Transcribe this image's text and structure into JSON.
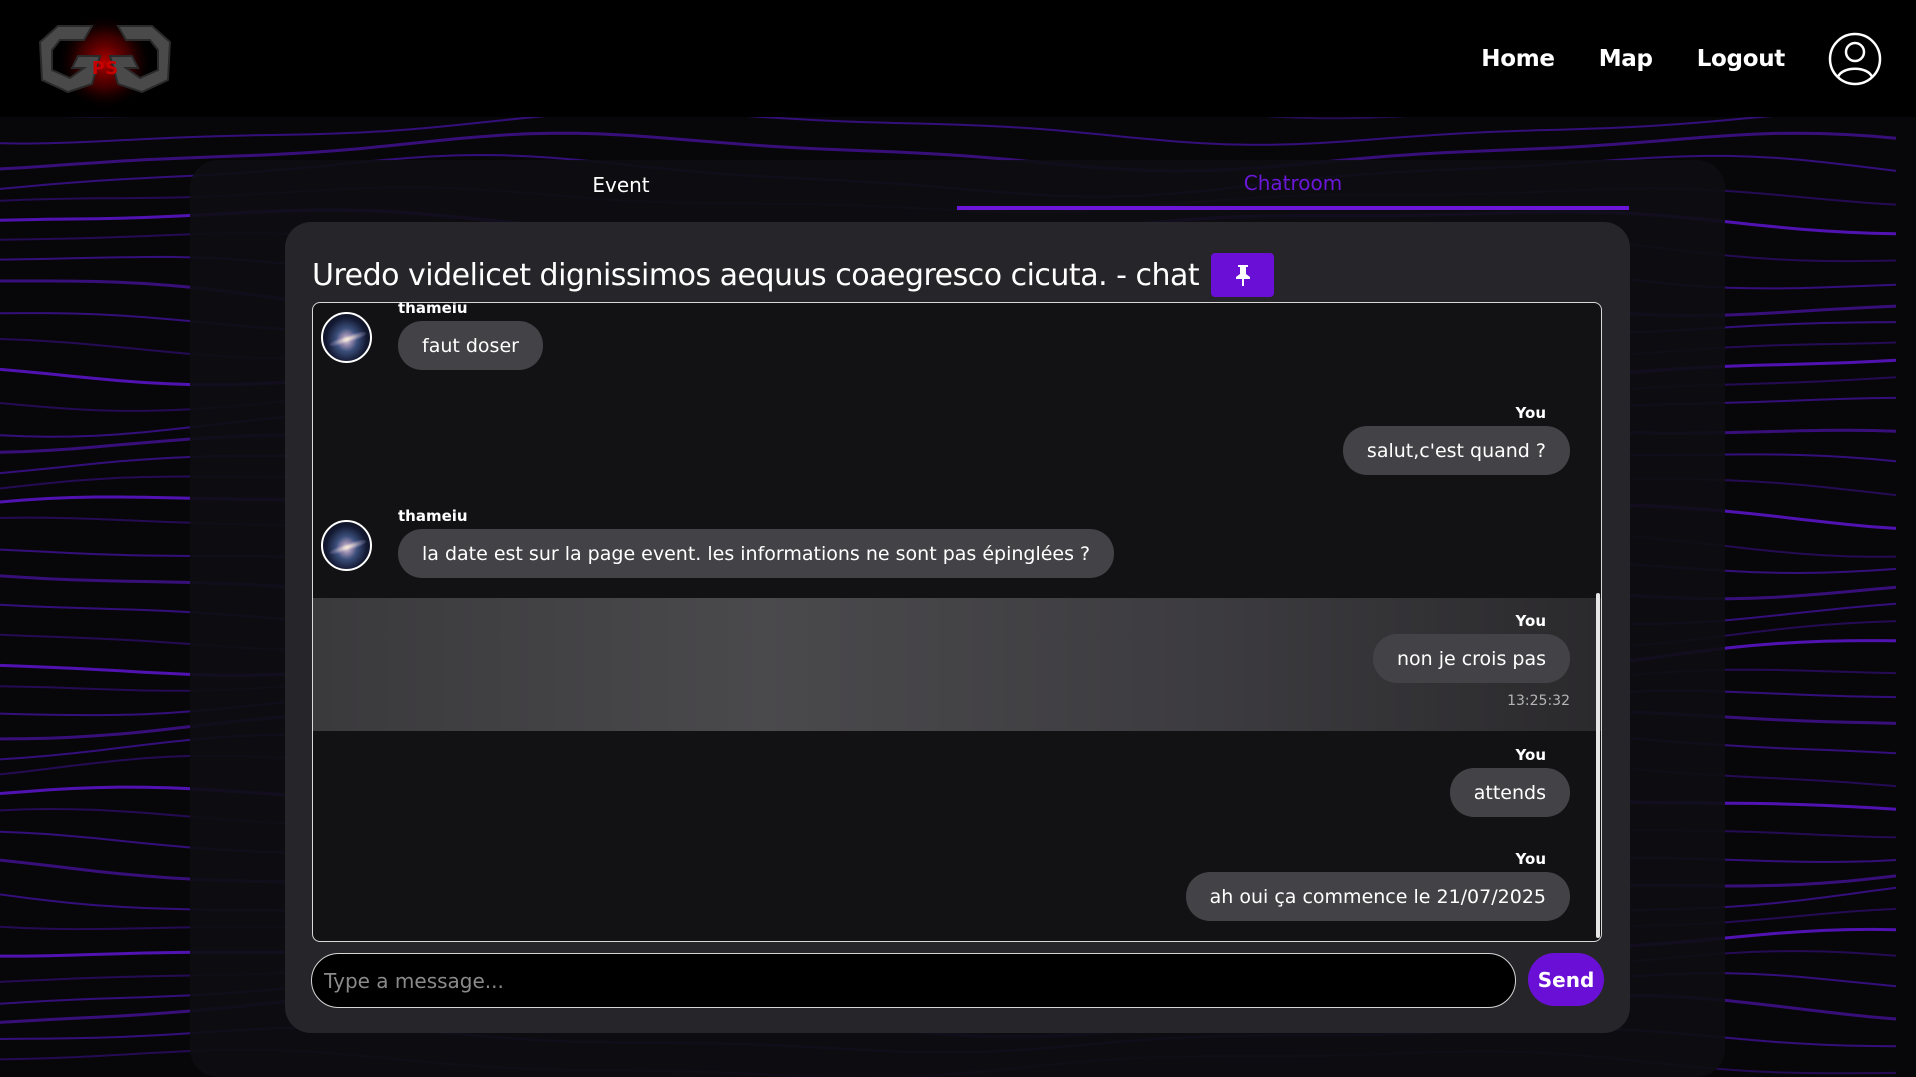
{
  "header": {
    "logo_text": "GG PS",
    "nav": {
      "home": "Home",
      "map": "Map",
      "logout": "Logout"
    }
  },
  "tabs": {
    "event": "Event",
    "chatroom": "Chatroom"
  },
  "chat": {
    "title": "Uredo videlicet dignissimos aequus coaegresco cicuta. - chat",
    "messages": [
      {
        "author": "thameiu",
        "text": "faut doser"
      },
      {
        "author": "You",
        "text": "salut,c'est quand ?"
      },
      {
        "author": "thameiu",
        "text": "la date est sur la page event. les informations ne sont pas épinglées ?"
      },
      {
        "author": "You",
        "text": "non je crois pas",
        "time": "13:25:32"
      },
      {
        "author": "You",
        "text": "attends"
      },
      {
        "author": "You",
        "text": "ah oui ça commence le 21/07/2025"
      }
    ],
    "input_placeholder": "Type a message...",
    "send_label": "Send"
  },
  "colors": {
    "accent": "#6a10d6",
    "background": "#07070a",
    "bubble": "#434246"
  },
  "icons": {
    "pin": "pin-icon",
    "profile": "user-profile-icon"
  }
}
